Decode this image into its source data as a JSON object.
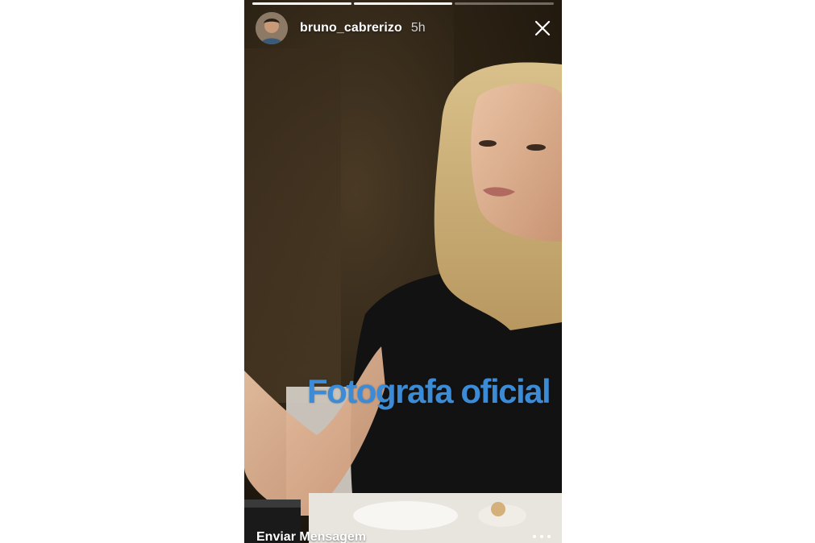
{
  "story": {
    "progress": [
      1.0,
      1.0,
      0.0
    ],
    "user": {
      "username": "bruno_cabrerizo",
      "time_ago": "5h",
      "avatar_icon": "avatar-photo"
    },
    "caption": {
      "text": "Fotografa oficial",
      "color": "#3b8bd6"
    },
    "footer": {
      "send_message_placeholder": "Enviar Mensagem",
      "more_icon": "more-horizontal-icon"
    },
    "close_icon": "close-icon"
  }
}
